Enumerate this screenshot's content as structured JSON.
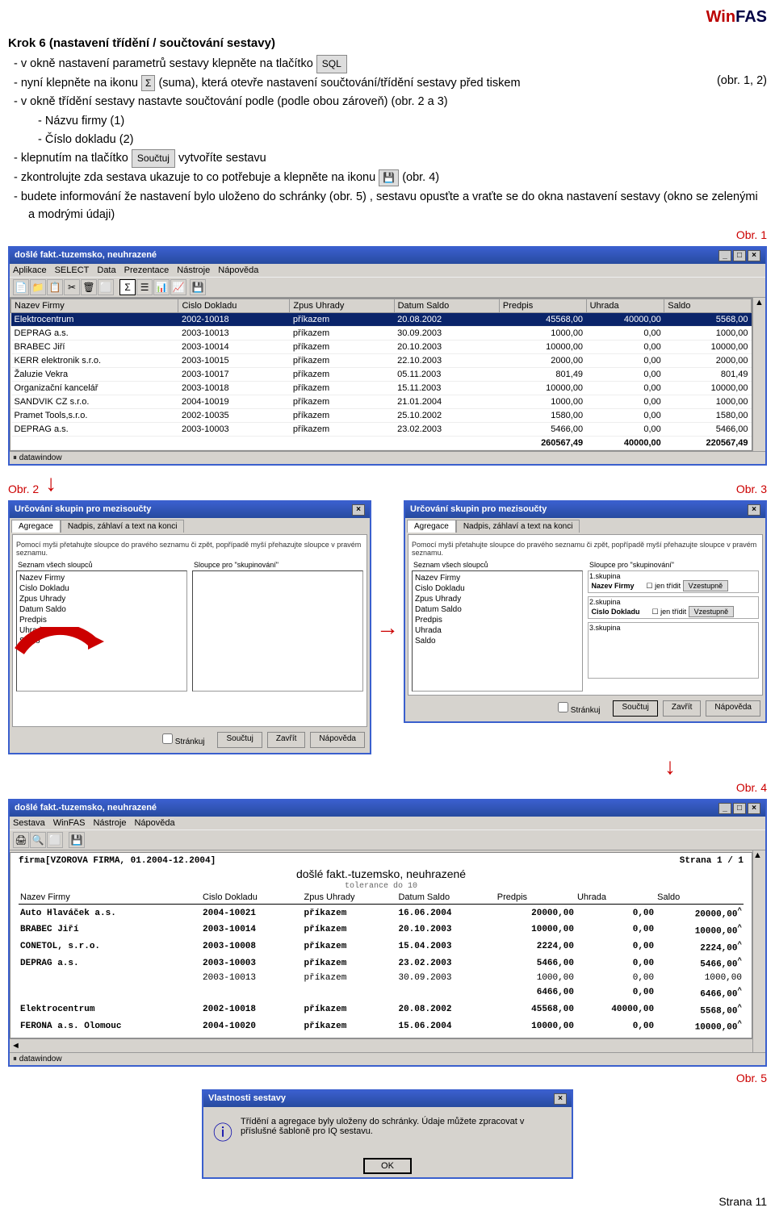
{
  "logo": {
    "win": "Win",
    "fas": "FAS"
  },
  "title": "Krok 6 (nastavení třídění / součtování sestavy)",
  "lines": {
    "l1": "v okně nastavení parametrů sestavy klepněte na tlačítko",
    "l1b": "SQL",
    "l2a": "nyní klepněte na ikonu",
    "l2i": "Σ",
    "l2b": "(suma), která otevře nastavení součtování/třídění sestavy před tiskem",
    "l2r": "(obr. 1, 2)",
    "l3": "v okně třídění sestavy nastavte součtování podle (podle obou zároveň) (obr. 2 a 3)",
    "l3a": "Názvu firmy (1)",
    "l3b": "Číslo dokladu (2)",
    "l4a": "klepnutím na tlačítko",
    "l4b": "Součtuj",
    "l4c": "vytvoříte sestavu",
    "l5a": "zkontrolujte zda sestava ukazuje to co potřebuje a klepněte na ikonu",
    "l5r": "(obr. 4)",
    "l6": "budete informování že nastavení bylo uloženo do schránky (obr. 5) , sestavu opusťte a vraťte se do okna nastavení sestavy (okno se zelenými a modrými údaji)"
  },
  "labels": {
    "obr1": "Obr. 1",
    "obr2": "Obr. 2",
    "obr3": "Obr. 3",
    "obr4": "Obr. 4",
    "obr5": "Obr. 5"
  },
  "win1": {
    "title": "došlé fakt.-tuzemsko, neuhrazené",
    "menu": [
      "Aplikace",
      "SELECT",
      "Data",
      "Prezentace",
      "Nástroje",
      "Nápověda"
    ],
    "sigma": "Σ",
    "cols": [
      "Nazev Firmy",
      "Cislo Dokladu",
      "Zpus Uhrady",
      "Datum Saldo",
      "Predpis",
      "Uhrada",
      "Saldo"
    ],
    "rows": [
      [
        "Elektrocentrum",
        "2002-10018",
        "příkazem",
        "20.08.2002",
        "45568,00",
        "40000,00",
        "5568,00"
      ],
      [
        "DEPRAG a.s.",
        "2003-10013",
        "příkazem",
        "30.09.2003",
        "1000,00",
        "0,00",
        "1000,00"
      ],
      [
        "BRABEC Jiří",
        "2003-10014",
        "příkazem",
        "20.10.2003",
        "10000,00",
        "0,00",
        "10000,00"
      ],
      [
        "KERR elektronik s.r.o.",
        "2003-10015",
        "příkazem",
        "22.10.2003",
        "2000,00",
        "0,00",
        "2000,00"
      ],
      [
        "Žaluzie Vekra",
        "2003-10017",
        "příkazem",
        "05.11.2003",
        "801,49",
        "0,00",
        "801,49"
      ],
      [
        "Organizační kancelář",
        "2003-10018",
        "příkazem",
        "15.11.2003",
        "10000,00",
        "0,00",
        "10000,00"
      ],
      [
        "SANDVIK CZ s.r.o.",
        "2004-10019",
        "příkazem",
        "21.01.2004",
        "1000,00",
        "0,00",
        "1000,00"
      ],
      [
        "Pramet Tools,s.r.o.",
        "2002-10035",
        "příkazem",
        "25.10.2002",
        "1580,00",
        "0,00",
        "1580,00"
      ],
      [
        "DEPRAG a.s.",
        "2003-10003",
        "příkazem",
        "23.02.2003",
        "5466,00",
        "0,00",
        "5466,00"
      ]
    ],
    "totals": [
      "260567,49",
      "40000,00",
      "220567,49"
    ],
    "status": "datawindow"
  },
  "dlg": {
    "title": "Určování skupin pro mezisoučty",
    "tabs": [
      "Agregace",
      "Nadpis, záhlaví a text na konci"
    ],
    "hint": "Pomocí myši přetahujte sloupce do pravého seznamu či zpět, popřípadě myší přehazujte sloupce v pravém seznamu.",
    "leftLbl": "Seznam všech sloupců",
    "rightLbl": "Sloupce pro \"skupinování\"",
    "cols": [
      "Nazev Firmy",
      "Cislo Dokladu",
      "Zpus Uhrady",
      "Datum Saldo",
      "Predpis",
      "Uhrada",
      "Saldo"
    ],
    "g1": "1.skupina",
    "g1v": "Nazev Firmy",
    "g2": "2.skupina",
    "g2v": "Cislo Dokladu",
    "g3": "3.skupina",
    "sort": "jen třídit",
    "dir": "Vzestupně",
    "btns": {
      "strankuj": "Stránkuj",
      "souctuj": "Součtuj",
      "zavrit": "Zavřít",
      "napoveda": "Nápověda"
    }
  },
  "win4": {
    "title": "došlé fakt.-tuzemsko, neuhrazené",
    "menu": [
      "Sestava",
      "WinFAS",
      "Nástroje",
      "Nápověda"
    ],
    "firma": "firma[VZOROVA FIRMA, 01.2004-12.2004]",
    "page": "Strana 1 / 1",
    "rtitle": "došlé fakt.-tuzemsko, neuhrazené",
    "sub": "tolerance do 10",
    "cols": [
      "Nazev Firmy",
      "Cislo Dokladu",
      "Zpus Uhrady",
      "Datum Saldo",
      "Predpis",
      "Uhrada",
      "Saldo"
    ],
    "rows": [
      {
        "b": 1,
        "c": [
          "Auto Hlaváček a.s.",
          "2004-10021",
          "příkazem",
          "16.06.2004",
          "20000,00",
          "0,00",
          "20000,00"
        ]
      },
      {
        "b": 1,
        "c": [
          "BRABEC Jiří",
          "2003-10014",
          "příkazem",
          "20.10.2003",
          "10000,00",
          "0,00",
          "10000,00"
        ]
      },
      {
        "b": 1,
        "c": [
          "CONETOL, s.r.o.",
          "2003-10008",
          "příkazem",
          "15.04.2003",
          "2224,00",
          "0,00",
          "2224,00"
        ]
      },
      {
        "b": 1,
        "c": [
          "DEPRAG a.s.",
          "2003-10003",
          "příkazem",
          "23.02.2003",
          "5466,00",
          "0,00",
          "5466,00"
        ]
      },
      {
        "b": 0,
        "c": [
          "",
          "2003-10013",
          "příkazem",
          "30.09.2003",
          "1000,00",
          "0,00",
          "1000,00"
        ]
      },
      {
        "b": 1,
        "c": [
          "",
          "",
          "",
          "",
          "6466,00",
          "0,00",
          "6466,00"
        ]
      },
      {
        "b": 1,
        "c": [
          "Elektrocentrum",
          "2002-10018",
          "příkazem",
          "20.08.2002",
          "45568,00",
          "40000,00",
          "5568,00"
        ]
      },
      {
        "b": 1,
        "c": [
          "FERONA a.s. Olomouc",
          "2004-10020",
          "příkazem",
          "15.06.2004",
          "10000,00",
          "0,00",
          "10000,00"
        ]
      }
    ],
    "status": "datawindow"
  },
  "msg": {
    "title": "Vlastnosti sestavy",
    "text": "Třídění a agregace byly uloženy do schránky. Údaje můžete zpracovat v příslušné šabloně pro IQ sestavu.",
    "ok": "OK"
  },
  "footer": "Strana 11"
}
